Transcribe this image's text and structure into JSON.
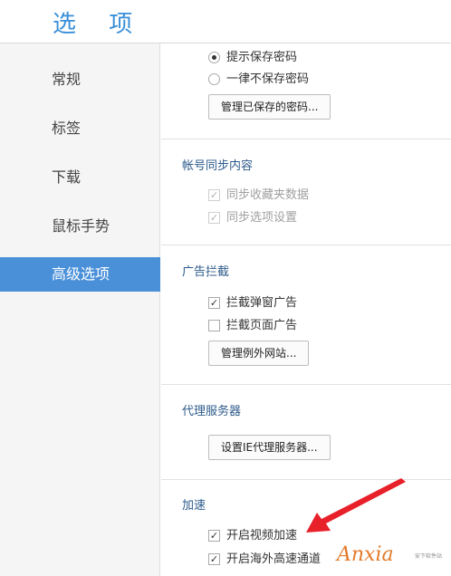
{
  "header": {
    "title": "选 项"
  },
  "sidebar": {
    "items": [
      {
        "label": "常规"
      },
      {
        "label": "标签"
      },
      {
        "label": "下载"
      },
      {
        "label": "鼠标手势"
      },
      {
        "label": "高级选项",
        "active": true
      }
    ]
  },
  "passwords": {
    "options": [
      {
        "label": "提示保存密码",
        "selected": true
      },
      {
        "label": "一律不保存密码",
        "selected": false
      }
    ],
    "manage_button": "管理已保存的密码..."
  },
  "sync": {
    "title": "帐号同步内容",
    "items": [
      {
        "label": "同步收藏夹数据",
        "checked": true,
        "disabled": true
      },
      {
        "label": "同步选项设置",
        "checked": true,
        "disabled": true
      }
    ]
  },
  "adblock": {
    "title": "广告拦截",
    "items": [
      {
        "label": "拦截弹窗广告",
        "checked": true
      },
      {
        "label": "拦截页面广告",
        "checked": false
      }
    ],
    "manage_button": "管理例外网站..."
  },
  "proxy": {
    "title": "代理服务器",
    "button": "设置IE代理服务器..."
  },
  "acceleration": {
    "title": "加速",
    "items": [
      {
        "label": "开启视频加速",
        "checked": true
      },
      {
        "label": "开启海外高速通道",
        "checked": true
      }
    ]
  },
  "watermark": {
    "brand": "Anxia",
    "sub": "安下软件站"
  },
  "colors": {
    "accent": "#4a90d9",
    "title": "#3a8fd8",
    "arrow": "#e8202a"
  }
}
